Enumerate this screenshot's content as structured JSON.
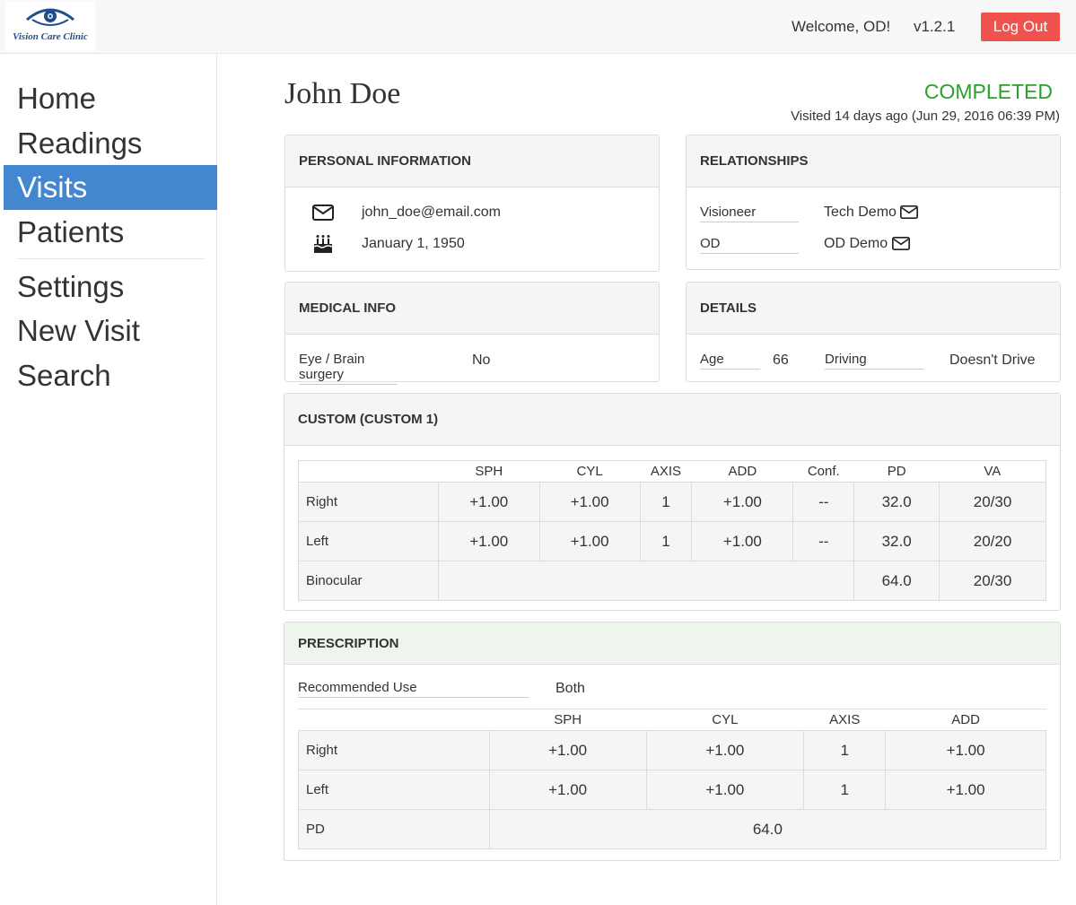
{
  "header": {
    "logo_text": "Vision Care Clinic",
    "welcome": "Welcome, OD!",
    "version": "v1.2.1",
    "logout_label": "Log Out",
    "logout_color": "#f0534e"
  },
  "sidebar": {
    "items": [
      {
        "label": "Home"
      },
      {
        "label": "Readings"
      },
      {
        "label": "Visits",
        "active": true
      },
      {
        "label": "Patients"
      },
      {
        "label": "Settings"
      },
      {
        "label": "New Visit"
      },
      {
        "label": "Search"
      }
    ],
    "active_color": "#4287cf"
  },
  "visit": {
    "patient_name": "John Doe",
    "status": "COMPLETED",
    "status_color": "#2aa12a",
    "visited_text": "Visited 14 days ago (Jun 29, 2016 06:39 PM)"
  },
  "personal_info": {
    "title": "PERSONAL INFORMATION",
    "email": "john_doe@email.com",
    "email_icon": "envelope-icon",
    "birthday": "January 1, 1950",
    "birthday_icon": "birthday-cake-icon"
  },
  "relationships": {
    "title": "RELATIONSHIPS",
    "rows": [
      {
        "label": "Visioneer",
        "value": "Tech Demo"
      },
      {
        "label": "OD",
        "value": "OD Demo"
      }
    ]
  },
  "medical_info": {
    "title": "MEDICAL INFO",
    "label": "Eye / Brain surgery",
    "value": "No"
  },
  "details": {
    "title": "DETAILS",
    "age_label": "Age",
    "age_value": "66",
    "driving_label": "Driving",
    "driving_value": "Doesn't Drive"
  },
  "custom": {
    "title": "CUSTOM (CUSTOM 1)",
    "columns": [
      "SPH",
      "CYL",
      "AXIS",
      "ADD",
      "Conf.",
      "PD",
      "VA"
    ],
    "rows": [
      {
        "label": "Right",
        "cells": [
          "+1.00",
          "+1.00",
          "1",
          "+1.00",
          "--",
          "32.0",
          "20/30"
        ]
      },
      {
        "label": "Left",
        "cells": [
          "+1.00",
          "+1.00",
          "1",
          "+1.00",
          "--",
          "32.0",
          "20/20"
        ]
      }
    ],
    "binocular": {
      "label": "Binocular",
      "pd": "64.0",
      "va": "20/30"
    }
  },
  "prescription": {
    "title": "PRESCRIPTION",
    "recommended_label": "Recommended Use",
    "recommended_value": "Both",
    "columns": [
      "SPH",
      "CYL",
      "AXIS",
      "ADD"
    ],
    "rows": [
      {
        "label": "Right",
        "cells": [
          "+1.00",
          "+1.00",
          "1",
          "+1.00"
        ]
      },
      {
        "label": "Left",
        "cells": [
          "+1.00",
          "+1.00",
          "1",
          "+1.00"
        ]
      }
    ],
    "pd_label": "PD",
    "pd_value": "64.0"
  }
}
